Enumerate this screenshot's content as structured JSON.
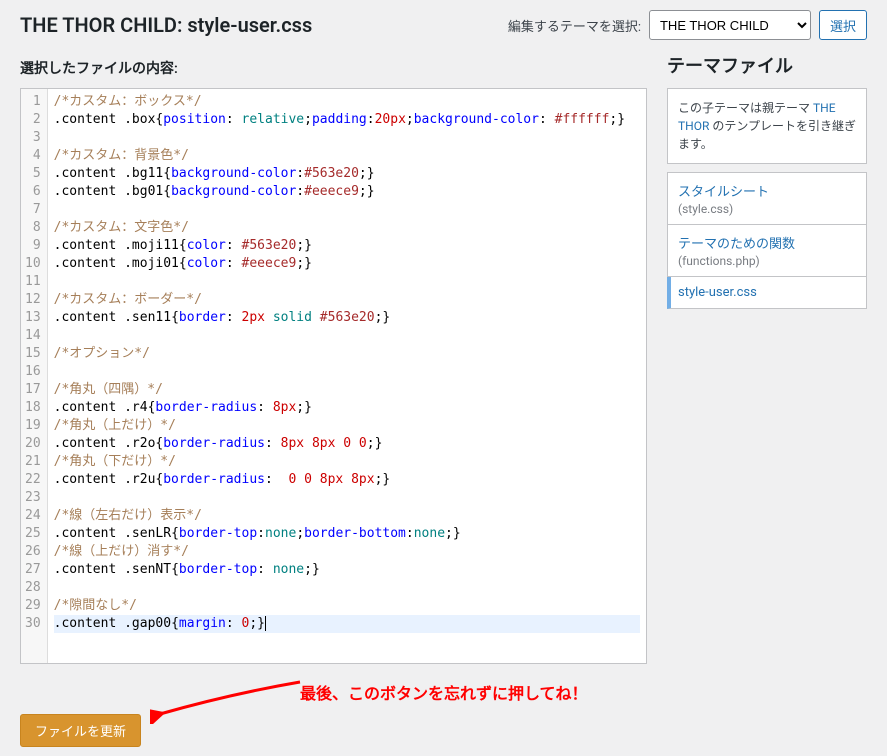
{
  "header": {
    "title": "THE THOR CHILD: style-user.css",
    "theme_select_label": "編集するテーマを選択:",
    "theme_selected": "THE THOR CHILD",
    "select_button": "選択"
  },
  "subheader": "選択したファイルの内容:",
  "sidebar": {
    "title": "テーマファイル",
    "notice_prefix": "この子テーマは親テーマ ",
    "notice_link": "THE THOR",
    "notice_suffix": " のテンプレートを引き継ぎます。",
    "files": [
      {
        "label": "スタイルシート",
        "sub": "(style.css)",
        "active": false
      },
      {
        "label": "テーマのための関数",
        "sub": "(functions.php)",
        "active": false
      },
      {
        "label": "style-user.css",
        "sub": "",
        "active": true
      }
    ]
  },
  "code": {
    "lines": [
      {
        "n": 1,
        "tokens": [
          {
            "t": "/*カスタム：ボックス*/",
            "c": "c-comment"
          }
        ]
      },
      {
        "n": 2,
        "tokens": [
          {
            "t": ".content .box",
            "c": "c-selector"
          },
          {
            "t": "{",
            "c": "c-brace"
          },
          {
            "t": "position",
            "c": "c-prop"
          },
          {
            "t": ": ",
            "c": "c-colon"
          },
          {
            "t": "relative",
            "c": "c-val"
          },
          {
            "t": ";",
            "c": "c-colon"
          },
          {
            "t": "padding",
            "c": "c-prop"
          },
          {
            "t": ":",
            "c": "c-colon"
          },
          {
            "t": "20px",
            "c": "c-num"
          },
          {
            "t": ";",
            "c": "c-colon"
          },
          {
            "t": "background-color",
            "c": "c-prop"
          },
          {
            "t": ": ",
            "c": "c-colon"
          },
          {
            "t": "#ffffff",
            "c": "c-hex"
          },
          {
            "t": ";",
            "c": "c-colon"
          },
          {
            "t": "}",
            "c": "c-brace"
          }
        ]
      },
      {
        "n": 3,
        "tokens": []
      },
      {
        "n": 4,
        "tokens": [
          {
            "t": "/*カスタム：背景色*/",
            "c": "c-comment"
          }
        ]
      },
      {
        "n": 5,
        "tokens": [
          {
            "t": ".content .bg11",
            "c": "c-selector"
          },
          {
            "t": "{",
            "c": "c-brace"
          },
          {
            "t": "background-color",
            "c": "c-prop"
          },
          {
            "t": ":",
            "c": "c-colon"
          },
          {
            "t": "#563e20",
            "c": "c-hex"
          },
          {
            "t": ";",
            "c": "c-colon"
          },
          {
            "t": "}",
            "c": "c-brace"
          }
        ]
      },
      {
        "n": 6,
        "tokens": [
          {
            "t": ".content .bg01",
            "c": "c-selector"
          },
          {
            "t": "{",
            "c": "c-brace"
          },
          {
            "t": "background-color",
            "c": "c-prop"
          },
          {
            "t": ":",
            "c": "c-colon"
          },
          {
            "t": "#eeece9",
            "c": "c-hex"
          },
          {
            "t": ";",
            "c": "c-colon"
          },
          {
            "t": "}",
            "c": "c-brace"
          }
        ]
      },
      {
        "n": 7,
        "tokens": []
      },
      {
        "n": 8,
        "tokens": [
          {
            "t": "/*カスタム：文字色*/",
            "c": "c-comment"
          }
        ]
      },
      {
        "n": 9,
        "tokens": [
          {
            "t": ".content .moji11",
            "c": "c-selector"
          },
          {
            "t": "{",
            "c": "c-brace"
          },
          {
            "t": "color",
            "c": "c-prop"
          },
          {
            "t": ": ",
            "c": "c-colon"
          },
          {
            "t": "#563e20",
            "c": "c-hex"
          },
          {
            "t": ";",
            "c": "c-colon"
          },
          {
            "t": "}",
            "c": "c-brace"
          }
        ]
      },
      {
        "n": 10,
        "tokens": [
          {
            "t": ".content .moji01",
            "c": "c-selector"
          },
          {
            "t": "{",
            "c": "c-brace"
          },
          {
            "t": "color",
            "c": "c-prop"
          },
          {
            "t": ": ",
            "c": "c-colon"
          },
          {
            "t": "#eeece9",
            "c": "c-hex"
          },
          {
            "t": ";",
            "c": "c-colon"
          },
          {
            "t": "}",
            "c": "c-brace"
          }
        ]
      },
      {
        "n": 11,
        "tokens": []
      },
      {
        "n": 12,
        "tokens": [
          {
            "t": "/*カスタム：ボーダー*/",
            "c": "c-comment"
          }
        ]
      },
      {
        "n": 13,
        "tokens": [
          {
            "t": ".content .sen11",
            "c": "c-selector"
          },
          {
            "t": "{",
            "c": "c-brace"
          },
          {
            "t": "border",
            "c": "c-prop"
          },
          {
            "t": ": ",
            "c": "c-colon"
          },
          {
            "t": "2px",
            "c": "c-num"
          },
          {
            "t": " ",
            "c": "c-colon"
          },
          {
            "t": "solid",
            "c": "c-val"
          },
          {
            "t": " ",
            "c": "c-colon"
          },
          {
            "t": "#563e20",
            "c": "c-hex"
          },
          {
            "t": ";",
            "c": "c-colon"
          },
          {
            "t": "}",
            "c": "c-brace"
          }
        ]
      },
      {
        "n": 14,
        "tokens": []
      },
      {
        "n": 15,
        "tokens": [
          {
            "t": "/*オプション*/",
            "c": "c-comment"
          }
        ]
      },
      {
        "n": 16,
        "tokens": []
      },
      {
        "n": 17,
        "tokens": [
          {
            "t": "/*角丸（四隅）*/",
            "c": "c-comment"
          }
        ]
      },
      {
        "n": 18,
        "tokens": [
          {
            "t": ".content .r4",
            "c": "c-selector"
          },
          {
            "t": "{",
            "c": "c-brace"
          },
          {
            "t": "border-radius",
            "c": "c-prop"
          },
          {
            "t": ": ",
            "c": "c-colon"
          },
          {
            "t": "8px",
            "c": "c-num"
          },
          {
            "t": ";",
            "c": "c-colon"
          },
          {
            "t": "}",
            "c": "c-brace"
          }
        ]
      },
      {
        "n": 19,
        "tokens": [
          {
            "t": "/*角丸（上だけ）*/",
            "c": "c-comment"
          }
        ]
      },
      {
        "n": 20,
        "tokens": [
          {
            "t": ".content .r2o",
            "c": "c-selector"
          },
          {
            "t": "{",
            "c": "c-brace"
          },
          {
            "t": "border-radius",
            "c": "c-prop"
          },
          {
            "t": ": ",
            "c": "c-colon"
          },
          {
            "t": "8px",
            "c": "c-num"
          },
          {
            "t": " ",
            "c": "c-colon"
          },
          {
            "t": "8px",
            "c": "c-num"
          },
          {
            "t": " ",
            "c": "c-colon"
          },
          {
            "t": "0",
            "c": "c-num"
          },
          {
            "t": " ",
            "c": "c-colon"
          },
          {
            "t": "0",
            "c": "c-num"
          },
          {
            "t": ";",
            "c": "c-colon"
          },
          {
            "t": "}",
            "c": "c-brace"
          }
        ]
      },
      {
        "n": 21,
        "tokens": [
          {
            "t": "/*角丸（下だけ）*/",
            "c": "c-comment"
          }
        ]
      },
      {
        "n": 22,
        "tokens": [
          {
            "t": ".content .r2u",
            "c": "c-selector"
          },
          {
            "t": "{",
            "c": "c-brace"
          },
          {
            "t": "border-radius",
            "c": "c-prop"
          },
          {
            "t": ":  ",
            "c": "c-colon"
          },
          {
            "t": "0",
            "c": "c-num"
          },
          {
            "t": " ",
            "c": "c-colon"
          },
          {
            "t": "0",
            "c": "c-num"
          },
          {
            "t": " ",
            "c": "c-colon"
          },
          {
            "t": "8px",
            "c": "c-num"
          },
          {
            "t": " ",
            "c": "c-colon"
          },
          {
            "t": "8px",
            "c": "c-num"
          },
          {
            "t": ";",
            "c": "c-colon"
          },
          {
            "t": "}",
            "c": "c-brace"
          }
        ]
      },
      {
        "n": 23,
        "tokens": []
      },
      {
        "n": 24,
        "tokens": [
          {
            "t": "/*線（左右だけ）表示*/",
            "c": "c-comment"
          }
        ]
      },
      {
        "n": 25,
        "tokens": [
          {
            "t": ".content .senLR",
            "c": "c-selector"
          },
          {
            "t": "{",
            "c": "c-brace"
          },
          {
            "t": "border-top",
            "c": "c-prop"
          },
          {
            "t": ":",
            "c": "c-colon"
          },
          {
            "t": "none",
            "c": "c-val"
          },
          {
            "t": ";",
            "c": "c-colon"
          },
          {
            "t": "border-bottom",
            "c": "c-prop"
          },
          {
            "t": ":",
            "c": "c-colon"
          },
          {
            "t": "none",
            "c": "c-val"
          },
          {
            "t": ";",
            "c": "c-colon"
          },
          {
            "t": "}",
            "c": "c-brace"
          }
        ]
      },
      {
        "n": 26,
        "tokens": [
          {
            "t": "/*線（上だけ）消す*/",
            "c": "c-comment"
          }
        ]
      },
      {
        "n": 27,
        "tokens": [
          {
            "t": ".content .senNT",
            "c": "c-selector"
          },
          {
            "t": "{",
            "c": "c-brace"
          },
          {
            "t": "border-top",
            "c": "c-prop"
          },
          {
            "t": ": ",
            "c": "c-colon"
          },
          {
            "t": "none",
            "c": "c-val"
          },
          {
            "t": ";",
            "c": "c-colon"
          },
          {
            "t": "}",
            "c": "c-brace"
          }
        ]
      },
      {
        "n": 28,
        "tokens": []
      },
      {
        "n": 29,
        "tokens": [
          {
            "t": "/*隙間なし*/",
            "c": "c-comment"
          }
        ]
      },
      {
        "n": 30,
        "active": true,
        "tokens": [
          {
            "t": ".content .gap00",
            "c": "c-selector"
          },
          {
            "t": "{",
            "c": "c-brace"
          },
          {
            "t": "margin",
            "c": "c-prop"
          },
          {
            "t": ": ",
            "c": "c-colon"
          },
          {
            "t": "0",
            "c": "c-num"
          },
          {
            "t": ";",
            "c": "c-colon"
          },
          {
            "t": "}",
            "c": "c-brace"
          }
        ]
      }
    ]
  },
  "annotation": "最後、このボタンを忘れずに押してね！",
  "update_button": "ファイルを更新"
}
